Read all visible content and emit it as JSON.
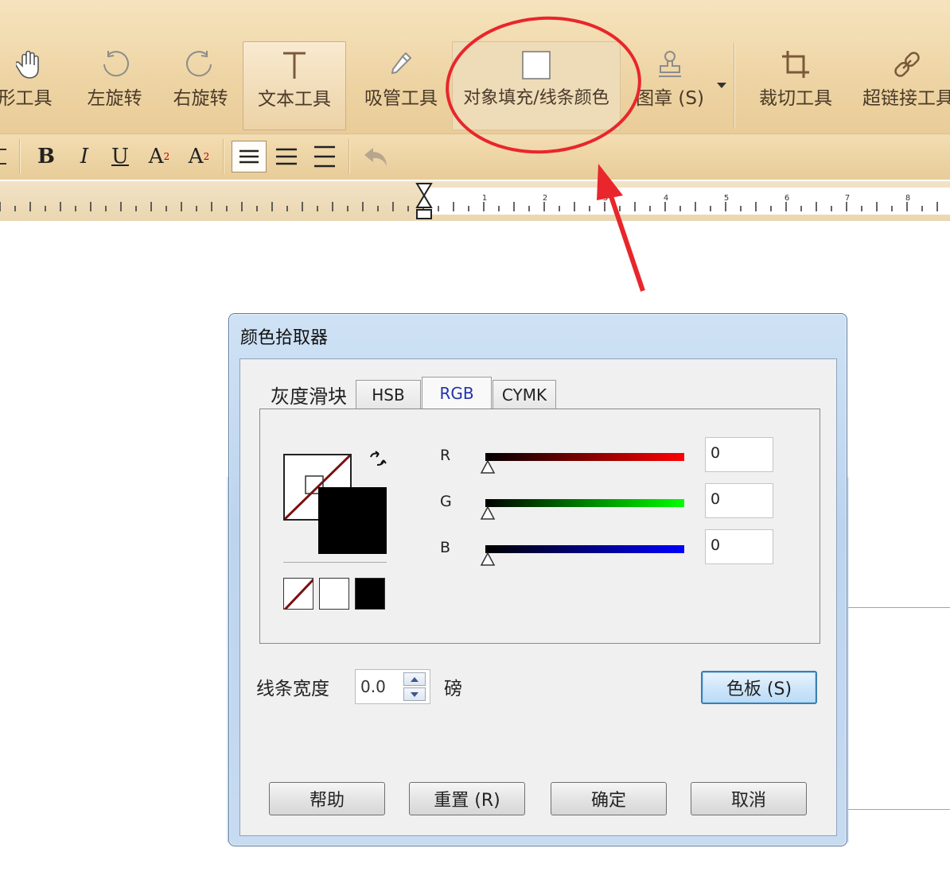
{
  "toolbar": {
    "tools": [
      {
        "label": "形工具",
        "icon": "hand-icon"
      },
      {
        "label": "左旋转",
        "icon": "rotate-left-icon"
      },
      {
        "label": "右旋转",
        "icon": "rotate-right-icon"
      },
      {
        "label": "文本工具",
        "icon": "text-tool-icon"
      },
      {
        "label": "吸管工具",
        "icon": "eyedropper-icon"
      },
      {
        "label": "对象填充/线条颜色",
        "icon": "color-swatch-icon"
      },
      {
        "label": "图章 (S)",
        "icon": "stamp-icon"
      },
      {
        "label": "裁切工具",
        "icon": "crop-icon"
      },
      {
        "label": "超链接工具",
        "icon": "link-icon"
      }
    ]
  },
  "format_bar": {
    "bold": "B",
    "italic": "I",
    "underline": "U",
    "superscript_base": "A",
    "superscript_mark": "2",
    "subscript_base": "A",
    "subscript_mark": "2",
    "icons": [
      "align-left-icon",
      "align-center-icon",
      "align-right-icon",
      "undo-icon"
    ]
  },
  "ruler": {
    "labels": [
      "1",
      "2",
      "3",
      "4",
      "5",
      "6",
      "7",
      "8"
    ]
  },
  "dialog": {
    "title": "颜色拾取器",
    "tabs": [
      "灰度滑块",
      "HSB",
      "RGB",
      "CYMK"
    ],
    "active_tab": "RGB",
    "channels": [
      {
        "label": "R",
        "value": "0",
        "color": "#ff0000"
      },
      {
        "label": "G",
        "value": "0",
        "color": "#00ff00"
      },
      {
        "label": "B",
        "value": "0",
        "color": "#0000ff"
      }
    ],
    "line_width_label": "线条宽度",
    "line_width_value": "0.0",
    "line_width_unit": "磅",
    "palette_button": "色板 (S)",
    "buttons": {
      "help": "帮助",
      "reset": "重置 (R)",
      "ok": "确定",
      "cancel": "取消"
    }
  },
  "colors": {
    "toolbar_bg": "#efd6a8",
    "annotation_red": "#e8262b",
    "dialog_frame": "#c6daf0",
    "active_tab_text": "#2233aa"
  }
}
